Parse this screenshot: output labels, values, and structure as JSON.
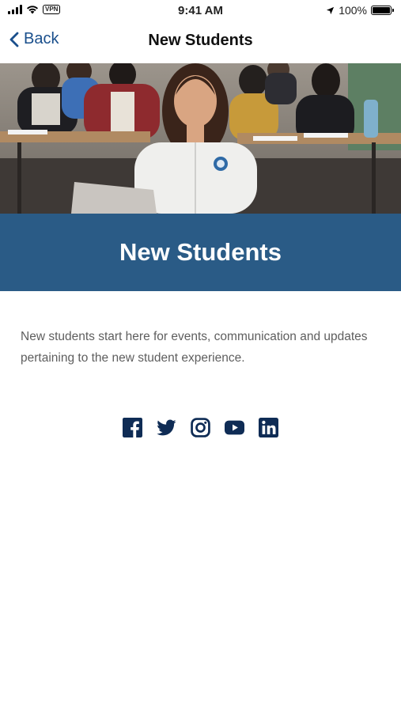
{
  "status_bar": {
    "vpn_label": "VPN",
    "time": "9:41 AM",
    "battery": "100%"
  },
  "nav": {
    "back_label": "Back",
    "title": "New Students"
  },
  "banner": {
    "title": "New Students"
  },
  "description": "New students start here for events, communication and updates pertaining to the new student experience.",
  "social": {
    "icons": [
      "facebook-icon",
      "twitter-icon",
      "instagram-icon",
      "youtube-icon",
      "linkedin-icon"
    ]
  },
  "colors": {
    "accent": "#1a4f8c",
    "banner": "#2a5b86",
    "body_text": "#5e5e5e",
    "social_icon": "#0f2c55"
  }
}
